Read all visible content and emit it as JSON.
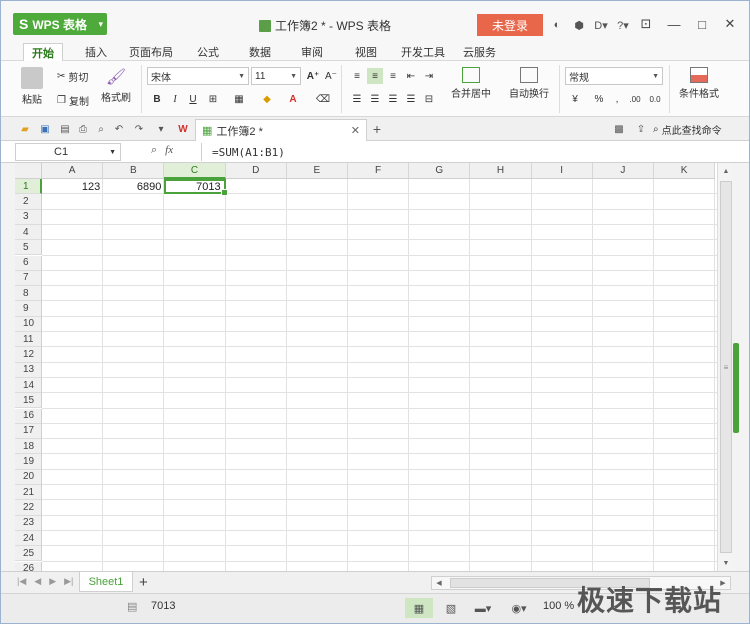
{
  "app": {
    "menu_label": "WPS 表格",
    "window_title": "工作簿2 * - WPS 表格",
    "login_label": "未登录"
  },
  "menu_tabs": [
    "开始",
    "插入",
    "页面布局",
    "公式",
    "数据",
    "审阅",
    "视图",
    "开发工具",
    "云服务"
  ],
  "ribbon": {
    "paste_label": "粘贴",
    "cut_label": "剪切",
    "copy_label": "复制",
    "format_painter_label": "格式刷",
    "font_name": "宋体",
    "font_size": "11",
    "merge_label": "合并居中",
    "wrap_label": "自动换行",
    "number_format": "常规",
    "cond_format_label": "条件格式",
    "percent": "%",
    "inc_decimal": ".00",
    "dec_decimal": "0.0"
  },
  "doc_tab": {
    "label": "工作簿2 *"
  },
  "search": {
    "label": "点此查找命令"
  },
  "formula_bar": {
    "cell_ref": "C1",
    "formula": "=SUM(A1:B1)"
  },
  "grid": {
    "columns": [
      "A",
      "B",
      "C",
      "D",
      "E",
      "F",
      "G",
      "H",
      "I",
      "J",
      "K"
    ],
    "rows": [
      "1",
      "2",
      "3",
      "4",
      "5",
      "6",
      "7",
      "8",
      "9",
      "10",
      "11",
      "12",
      "13",
      "14",
      "15",
      "16",
      "17",
      "18",
      "19",
      "20",
      "21",
      "22",
      "23",
      "24",
      "25",
      "26"
    ],
    "cells": {
      "A1": "123",
      "B1": "6890",
      "C1": "7013"
    },
    "selected_cell": "C1"
  },
  "sheets": [
    "Sheet1"
  ],
  "status": {
    "value": "7013",
    "zoom": "100 %"
  },
  "watermark": "极速下载站",
  "colors": {
    "accent": "#4aa23a",
    "login": "#e8664a",
    "app_button": "#4eaa3b"
  }
}
